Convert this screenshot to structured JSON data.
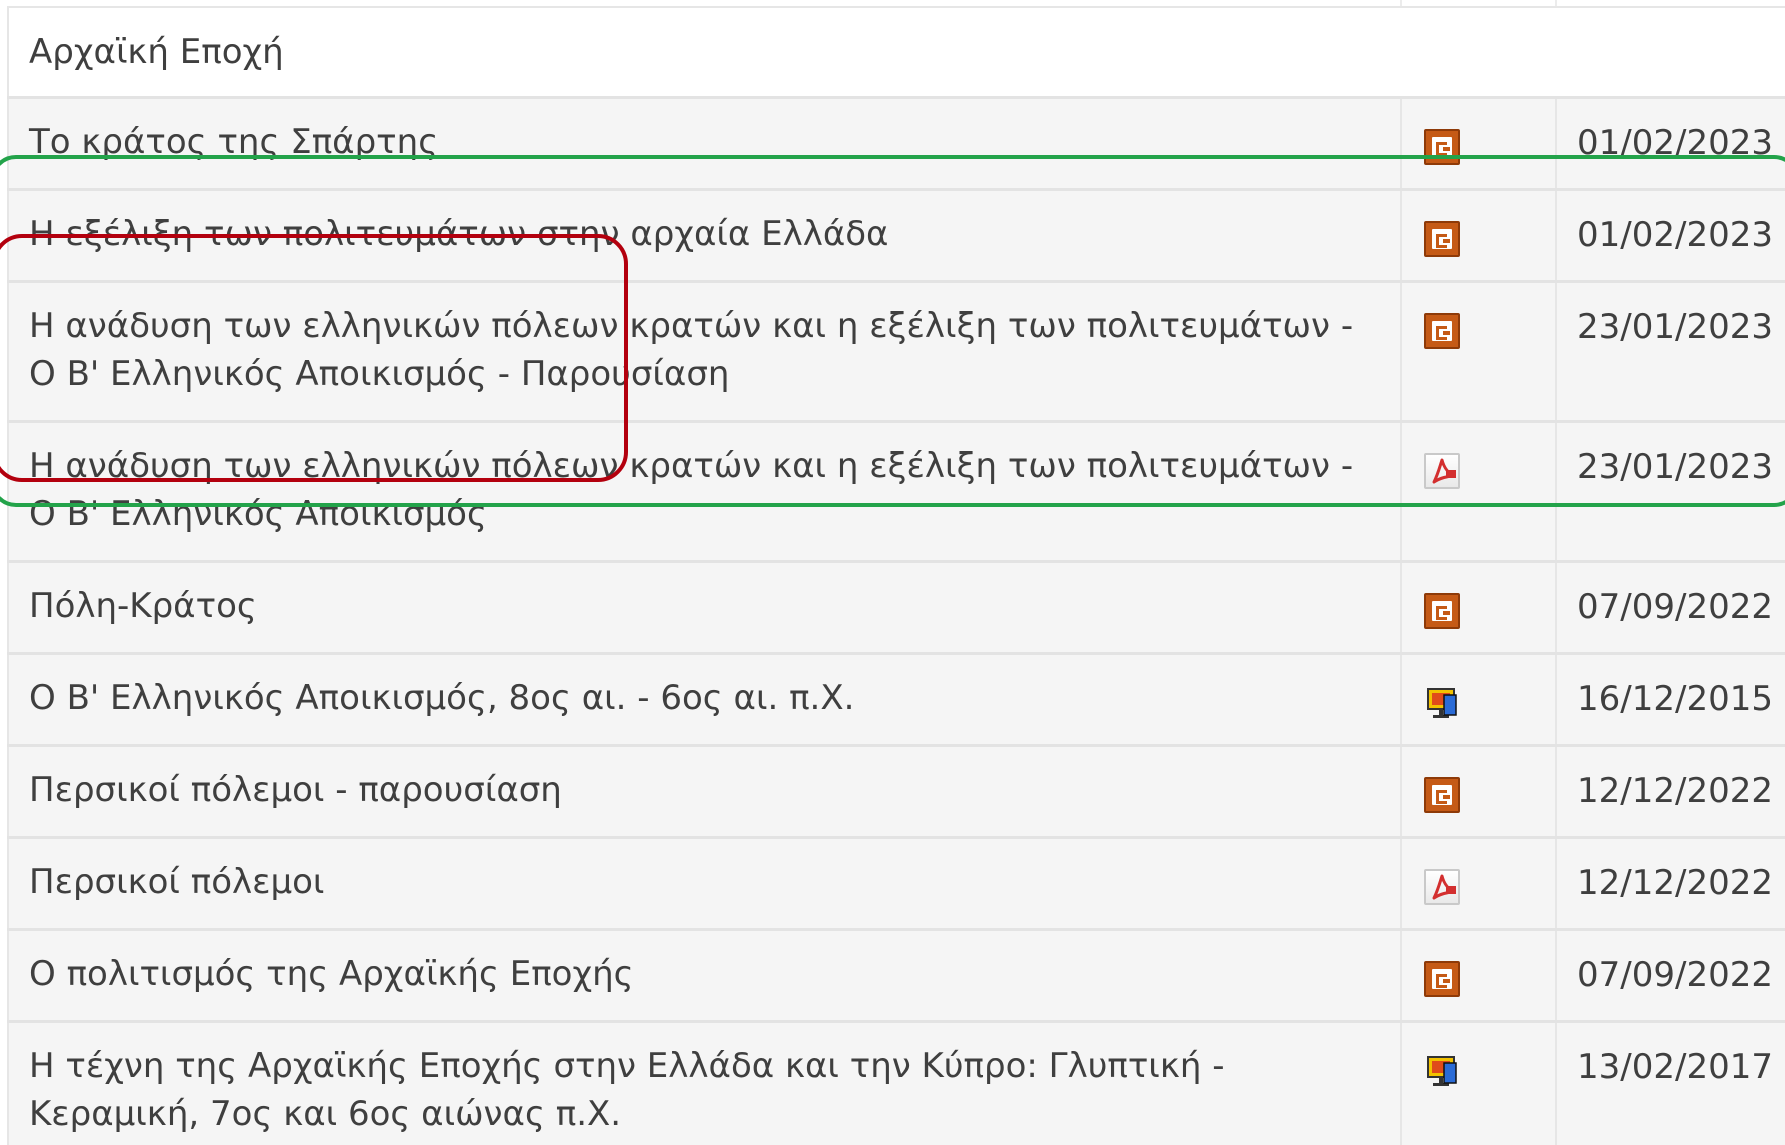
{
  "section": {
    "title": "Αρχαϊκή Εποχή"
  },
  "rows": [
    {
      "title": "Το κράτος της Σπάρτης",
      "icon": "presentation-icon",
      "date": "01/02/2023"
    },
    {
      "title": "Η εξέλιξη των πολιτευμάτων στην αρχαία Ελλάδα",
      "icon": "presentation-icon",
      "date": "01/02/2023"
    },
    {
      "title": "Η ανάδυση των ελληνικών πόλεων κρατών και η εξέλιξη των πολιτευμάτων - Ο Β' Ελληνικός Αποικισμός - Παρουσίαση",
      "icon": "presentation-icon",
      "date": "23/01/2023"
    },
    {
      "title": "Η ανάδυση των ελληνικών πόλεων κρατών και η εξέλιξη των πολιτευμάτων - Ο Β' Ελληνικός Αποικισμός",
      "icon": "pdf-icon",
      "date": "23/01/2023"
    },
    {
      "title": "Πόλη-Κράτος",
      "icon": "presentation-icon",
      "date": "07/09/2022"
    },
    {
      "title": "Ο Β' Ελληνικός Αποικισμός, 8ος αι. - 6ος αι. π.Χ.",
      "icon": "computer-presentation-icon",
      "date": "16/12/2015"
    },
    {
      "title": "Περσικοί πόλεμοι - παρουσίαση",
      "icon": "presentation-icon",
      "date": "12/12/2022"
    },
    {
      "title": "Περσικοί πόλεμοι",
      "icon": "pdf-icon",
      "date": "12/12/2022"
    },
    {
      "title": "Ο πολιτισμός της Αρχαϊκής Εποχής",
      "icon": "presentation-icon",
      "date": "07/09/2022"
    },
    {
      "title": "Η τέχνη της Αρχαϊκής Εποχής στην Ελλάδα και την Κύπρο: Γλυπτική - Κεραμική, 7ος και 6ος αιώνας π.Χ.",
      "icon": "computer-presentation-icon",
      "date": "13/02/2017"
    }
  ],
  "colors": {
    "row_background": "#f5f5f5",
    "text": "#3f3f3f",
    "ppt_orange": "#c55a16",
    "highlight_green": "#23a34a",
    "highlight_red": "#b3000e"
  }
}
